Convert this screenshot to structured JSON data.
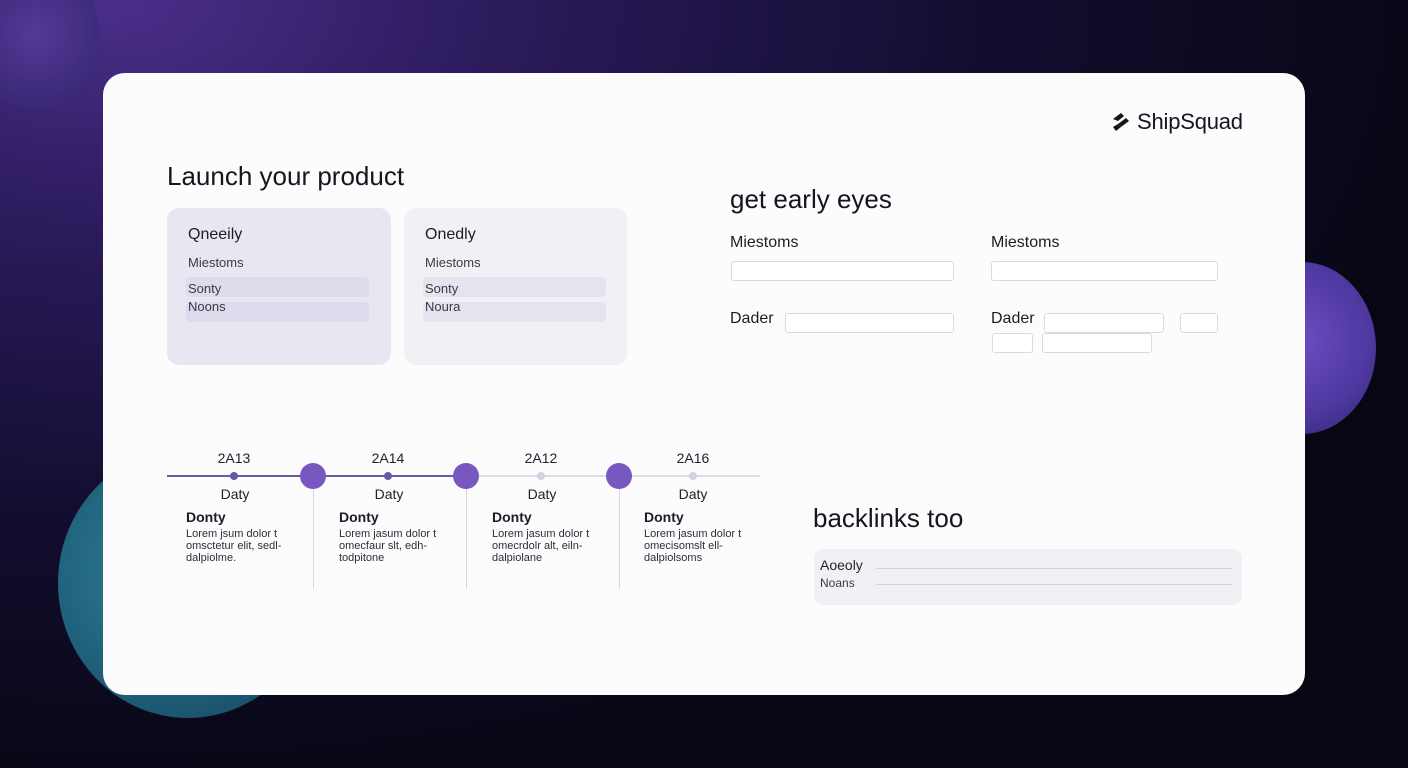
{
  "brand": {
    "name": "ShipSquad"
  },
  "launch": {
    "title": "Launch your product",
    "cards": [
      {
        "title": "Qneeily",
        "subtitle": "Miestoms",
        "row1": "Sonty",
        "row2": "Noons"
      },
      {
        "title": "Onedly",
        "subtitle": "Miestoms",
        "row1": "Sonty",
        "row2": "Noura"
      }
    ]
  },
  "eyes": {
    "title": "get early eyes",
    "left_label": "Miestoms",
    "right_label": "Miestoms",
    "left_date_label": "Dader",
    "right_date_label": "Dader"
  },
  "timeline": {
    "items": [
      {
        "year": "2A13",
        "day": "Daty",
        "heading": "Donty",
        "body": "Lorem jsum dolor t omsctetur elit, sedl- dalpiolme.",
        "state": "done"
      },
      {
        "year": "2A14",
        "day": "Daty",
        "heading": "Donty",
        "body": "Lorem jasum dolor t omecfaur slt, edh- todpitone",
        "state": "done"
      },
      {
        "year": "2A12",
        "day": "Daty",
        "heading": "Donty",
        "body": "Lorem jasum dolor t omecrdolr alt, eiln- dalpiolane",
        "state": "todo"
      },
      {
        "year": "2A16",
        "day": "Daty",
        "heading": "Donty",
        "body": "Lorem jasum dolor t omecisomslt ell- dalpiolsoms",
        "state": "todo"
      }
    ]
  },
  "backlinks": {
    "title": "backlinks too",
    "row1": "Aoeoly",
    "row2": "Noans"
  },
  "colors": {
    "accent": "#7858c0",
    "timeline_done": "#6f5aa8",
    "card_bg": "#fcfcfd",
    "background": "#070713"
  }
}
